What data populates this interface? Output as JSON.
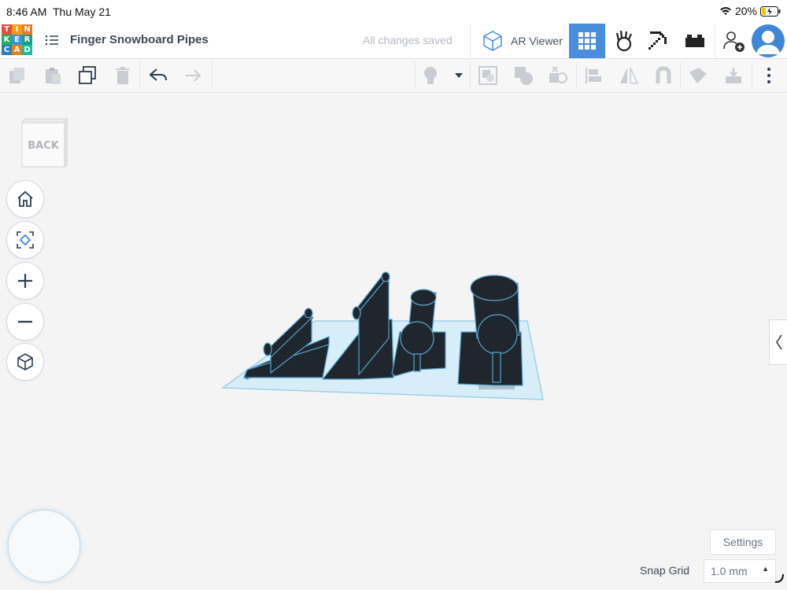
{
  "status_bar": {
    "time": "8:46 AM",
    "date": "Thu May 21",
    "battery": "20%"
  },
  "logo": {
    "letters": [
      "T",
      "I",
      "N",
      "K",
      "E",
      "R",
      "C",
      "A",
      "D"
    ],
    "colors": [
      "#e74c3c",
      "#f39c12",
      "#e67e22",
      "#27ae60",
      "#3498db",
      "#16a085",
      "#2980b9",
      "#e67e22",
      "#1abc9c"
    ]
  },
  "header": {
    "design_title": "Finger Snowboard Pipes",
    "save_status": "All changes saved",
    "ar_viewer_label": "AR Viewer"
  },
  "viewcube": {
    "face_label": "BACK"
  },
  "bottom": {
    "settings_label": "Settings",
    "snap_grid_label": "Snap Grid",
    "snap_grid_value": "1.0 mm"
  },
  "colors": {
    "accent": "#4a8ddc",
    "shape_fill": "#1f262d",
    "workplane": "#d3ecf7"
  }
}
